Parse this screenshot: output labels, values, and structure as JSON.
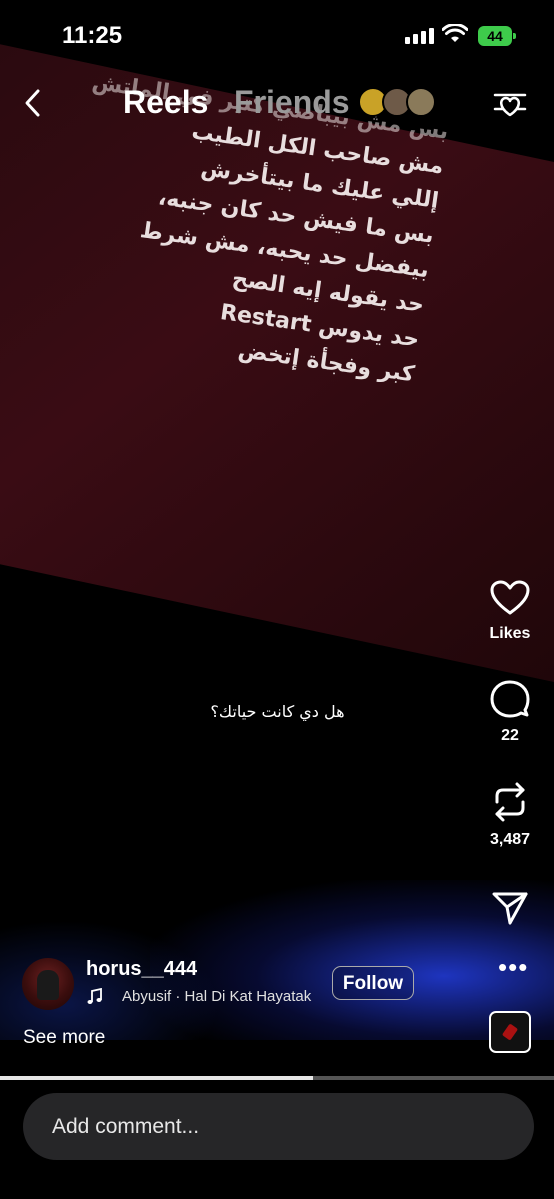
{
  "status_bar": {
    "time": "11:25",
    "battery": "44"
  },
  "header": {
    "tab_active": "Reels",
    "tab_inactive": "Friends"
  },
  "video": {
    "lyrics": [
      "بس مش بيباصي كتير في الماتش",
      "مش صاحب الكل الطيب",
      "إللي عليك ما بيتأخرش",
      "بس ما فيش حد كان جنبه،",
      "بيفضل حد يحبه، مش شرط",
      "حد يقوله إيه الصح",
      "حد يدوس Restart",
      "كبر وفجأة إتخض"
    ],
    "caption_overlay": "هل دي كانت حياتك؟"
  },
  "actions": {
    "likes_label": "Likes",
    "comments_count": "22",
    "reposts_count": "3,487"
  },
  "post": {
    "username": "horus__444",
    "music": "Abyusif · Hal Di Kat Hayatak",
    "follow_label": "Follow",
    "see_more": "See more"
  },
  "playback_progress": 0.565,
  "comment_box": {
    "placeholder": "Add comment..."
  },
  "icons": [
    "back-icon",
    "filter-icon",
    "heart-icon",
    "comment-icon",
    "repost-icon",
    "share-icon",
    "more-icon",
    "music-note-icon"
  ],
  "colors": {
    "battery": "#3ecb4b",
    "video_red": "#3a0c14",
    "glow_blue": "#2846ff"
  }
}
